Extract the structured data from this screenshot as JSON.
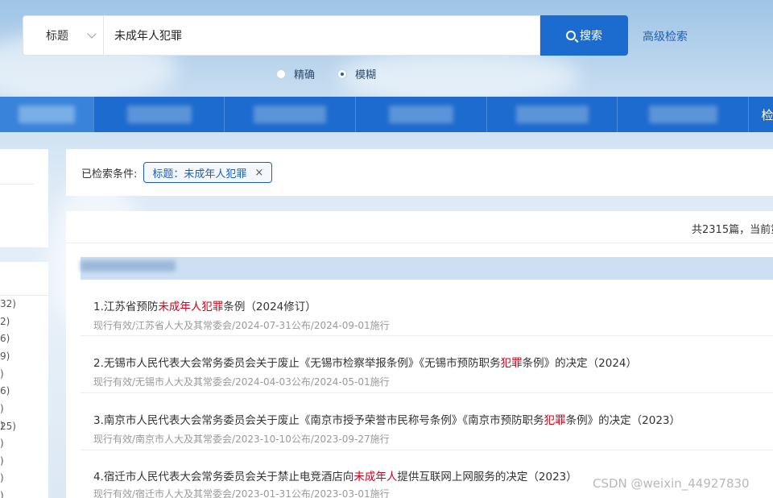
{
  "search": {
    "field_label": "标题",
    "query": "未成年人犯罪",
    "button_label": "搜索",
    "advanced_label": "高级检索",
    "modes": [
      {
        "label": "精确",
        "selected": false
      },
      {
        "label": "模糊",
        "selected": true
      }
    ]
  },
  "nav": {
    "last_label": "检"
  },
  "left_panel": {
    "counts": [
      "32)",
      "2)",
      "6)",
      "9)",
      ")",
      "6)",
      ")",
      ")",
      "25)",
      ")",
      ")",
      ")",
      ")"
    ]
  },
  "conditions": {
    "label": "已检索条件:",
    "tag_label": "标题：未成年人犯罪",
    "tag_close": "×"
  },
  "results": {
    "summary": "共2315篇，当前第",
    "items": [
      {
        "title_prefix": "1.江苏省预防",
        "title_highlight": "未成年人犯罪",
        "title_suffix": "条例（2024修订）",
        "meta": "现行有效/江苏省人大及其常委会/2024-07-31公布/2024-09-01施行"
      },
      {
        "title_prefix": "2.无锡市人民代表大会常务委员会关于废止《无锡市检察举报条例》《无锡市预防职务",
        "title_highlight": "犯罪",
        "title_suffix": "条例》的决定（2024）",
        "meta": "现行有效/无锡市人大及其常委会/2024-04-03公布/2024-05-01施行"
      },
      {
        "title_prefix": "3.南京市人民代表大会常务委员会关于废止《南京市授予荣誉市民称号条例》《南京市预防职务",
        "title_highlight": "犯罪",
        "title_suffix": "条例》的决定（2023）",
        "meta": "现行有效/南京市人大及其常委会/2023-10-10公布/2023-09-27施行"
      },
      {
        "title_prefix": "4.宿迁市人民代表大会常务委员会关于禁止电竞酒店向",
        "title_highlight": "未成年人",
        "title_suffix": "提供互联网上网服务的决定（2023）",
        "meta": "现行有效/宿迁市人大及其常委会/2023-01-31公布/2023-03-01施行"
      }
    ]
  },
  "watermark": "CSDN @weixin_44927830",
  "colors": {
    "brand_blue": "#1d6bce",
    "highlight_red": "#d0021b"
  }
}
